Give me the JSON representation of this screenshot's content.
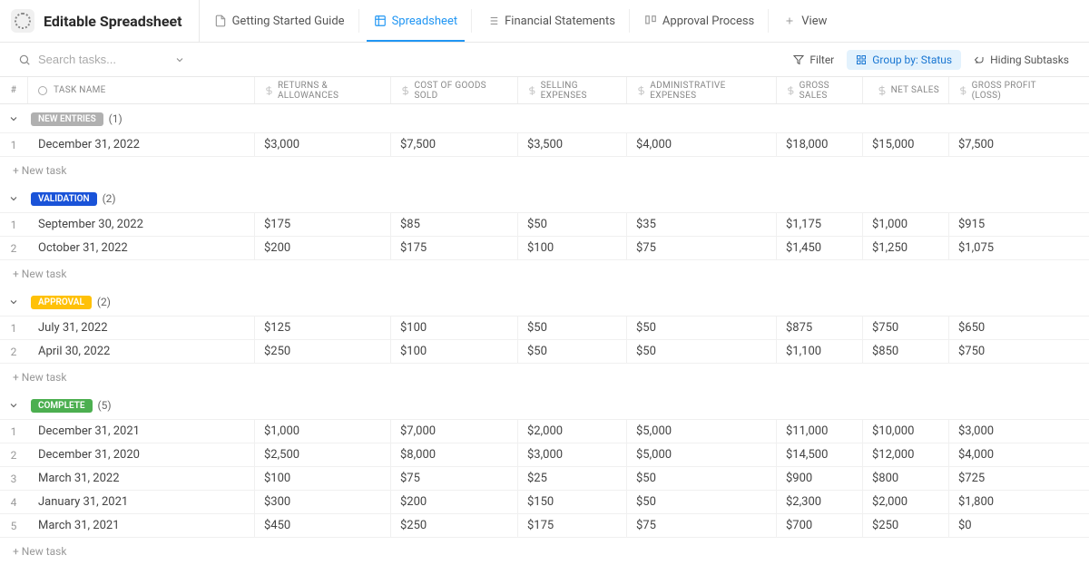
{
  "header": {
    "title": "Editable Spreadsheet",
    "tabs": [
      {
        "label": "Getting Started Guide"
      },
      {
        "label": "Spreadsheet"
      },
      {
        "label": "Financial Statements"
      },
      {
        "label": "Approval Process"
      },
      {
        "label": "View"
      }
    ]
  },
  "toolbar": {
    "search_placeholder": "Search tasks...",
    "filter": "Filter",
    "group_by": "Group by: Status",
    "hiding": "Hiding Subtasks"
  },
  "columns": {
    "num": "#",
    "task": "TASK NAME",
    "c1": "RETURNS & ALLOWANCES",
    "c2": "COST OF GOODS SOLD",
    "c3": "SELLING EXPENSES",
    "c4": "ADMINISTRATIVE EXPENSES",
    "c5": "GROSS SALES",
    "c6": "NET SALES",
    "c7": "GROSS PROFIT (LOSS)"
  },
  "new_task_label": "New task",
  "groups": [
    {
      "name": "NEW ENTRIES",
      "badge_class": "badge-new",
      "count": "(1)",
      "rows": [
        {
          "n": "1",
          "task": "December 31, 2022",
          "c1": "$3,000",
          "c2": "$7,500",
          "c3": "$3,500",
          "c4": "$4,000",
          "c5": "$18,000",
          "c6": "$15,000",
          "c7": "$7,500"
        }
      ]
    },
    {
      "name": "VALIDATION",
      "badge_class": "badge-validation",
      "count": "(2)",
      "rows": [
        {
          "n": "1",
          "task": "September 30, 2022",
          "c1": "$175",
          "c2": "$85",
          "c3": "$50",
          "c4": "$35",
          "c5": "$1,175",
          "c6": "$1,000",
          "c7": "$915"
        },
        {
          "n": "2",
          "task": "October 31, 2022",
          "c1": "$200",
          "c2": "$175",
          "c3": "$100",
          "c4": "$75",
          "c5": "$1,450",
          "c6": "$1,250",
          "c7": "$1,075"
        }
      ]
    },
    {
      "name": "APPROVAL",
      "badge_class": "badge-approval",
      "count": "(2)",
      "rows": [
        {
          "n": "1",
          "task": "July 31, 2022",
          "c1": "$125",
          "c2": "$100",
          "c3": "$50",
          "c4": "$50",
          "c5": "$875",
          "c6": "$750",
          "c7": "$650"
        },
        {
          "n": "2",
          "task": "April 30, 2022",
          "c1": "$250",
          "c2": "$100",
          "c3": "$50",
          "c4": "$50",
          "c5": "$1,100",
          "c6": "$850",
          "c7": "$750"
        }
      ]
    },
    {
      "name": "COMPLETE",
      "badge_class": "badge-complete",
      "count": "(5)",
      "rows": [
        {
          "n": "1",
          "task": "December 31, 2021",
          "c1": "$1,000",
          "c2": "$7,000",
          "c3": "$2,000",
          "c4": "$5,000",
          "c5": "$11,000",
          "c6": "$10,000",
          "c7": "$3,000"
        },
        {
          "n": "2",
          "task": "December 31, 2020",
          "c1": "$2,500",
          "c2": "$8,000",
          "c3": "$3,000",
          "c4": "$5,000",
          "c5": "$14,500",
          "c6": "$12,000",
          "c7": "$4,000"
        },
        {
          "n": "3",
          "task": "March 31, 2022",
          "c1": "$100",
          "c2": "$75",
          "c3": "$25",
          "c4": "$50",
          "c5": "$900",
          "c6": "$800",
          "c7": "$725"
        },
        {
          "n": "4",
          "task": "January 31, 2021",
          "c1": "$300",
          "c2": "$200",
          "c3": "$150",
          "c4": "$50",
          "c5": "$2,300",
          "c6": "$2,000",
          "c7": "$1,800"
        },
        {
          "n": "5",
          "task": "March 31, 2021",
          "c1": "$450",
          "c2": "$250",
          "c3": "$175",
          "c4": "$75",
          "c5": "$700",
          "c6": "$250",
          "c7": "$0"
        }
      ]
    }
  ]
}
